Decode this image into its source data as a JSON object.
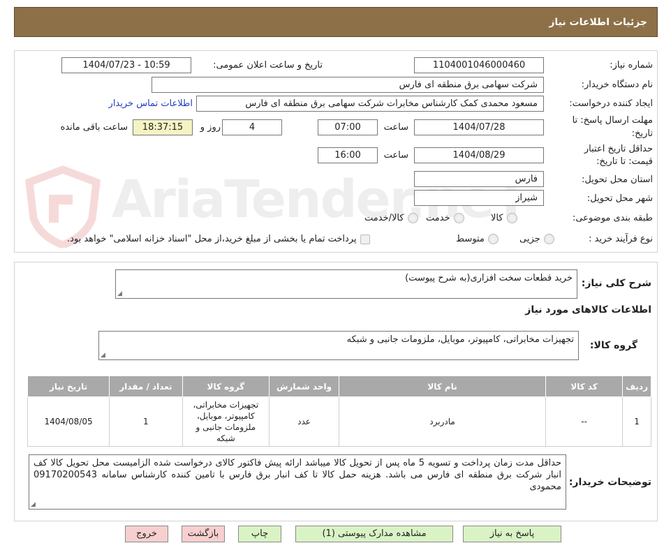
{
  "header": {
    "title": "جزئیات اطلاعات نیاز"
  },
  "watermark": {
    "text": "AriaTender.neT"
  },
  "fields": {
    "need_number_label": "شماره نیاز:",
    "need_number": "1104001046000460",
    "announce_label": "تاریخ و ساعت اعلان عمومی:",
    "announce_value": "1404/07/23 - 10:59",
    "buyer_org_label": "نام دستگاه خریدار:",
    "buyer_org": "شرکت سهامی برق منطقه ای فارس",
    "creator_label": "ایجاد کننده درخواست:",
    "creator": "مسعود محمدی کمک کارشناس مخابرات شرکت سهامی برق منطقه ای فارس",
    "contact_link": "اطلاعات تماس خریدار",
    "deadline_label_1": "مهلت ارسال پاسخ: تا",
    "deadline_label_2": "تاریخ:",
    "deadline_date": "1404/07/28",
    "time_word": "ساعت",
    "deadline_time": "07:00",
    "days_remaining": "4",
    "days_word": "روز و",
    "time_remaining": "18:37:15",
    "remaining_word": "ساعت باقی مانده",
    "validity_label_1": "حداقل تاریخ اعتبار",
    "validity_label_2": "قیمت: تا تاریخ:",
    "validity_date": "1404/08/29",
    "validity_time": "16:00",
    "province_label": "استان محل تحویل:",
    "province": "فارس",
    "city_label": "شهر محل تحویل:",
    "city": "شیراز",
    "category_label": "طبقه بندی موضوعی:",
    "category_options": [
      "کالا",
      "خدمت",
      "کالا/خدمت"
    ],
    "process_label": "نوع فرآیند خرید :",
    "process_options": [
      "جزیی",
      "متوسط"
    ],
    "treasury_note": "پرداخت تمام یا بخشی از مبلغ خرید،از محل \"اسناد خزانه اسلامی\" خواهد بود."
  },
  "summary": {
    "label": "شرح کلی نیاز:",
    "value": "خرید قطعات سخت افزاری(به شرح پیوست)",
    "items_title": "اطلاعات کالاهای مورد نیاز",
    "group_label": "گروه کالا:",
    "group_value": "تجهیزات مخابراتی، کامپیوتر، موبایل، ملزومات جانبی و شبکه"
  },
  "table": {
    "columns": [
      "ردیف",
      "کد کالا",
      "نام کالا",
      "واحد شمارش",
      "گروه کالا",
      "تعداد / مقدار",
      "تاریخ نیاز"
    ],
    "rows": [
      [
        "1",
        "--",
        "مادربرد",
        "عدد",
        "تجهیزات مخابراتی، کامپیوتر، موبایل، ملزومات جانبی و شبکه",
        "1",
        "1404/08/05"
      ]
    ]
  },
  "buyer_notes": {
    "label": "توضیحات خریدار:",
    "value": "حداقل مدت زمان پرداخت و تسویه 5 ماه پس از تحویل کالا میباشد ارائه پیش فاکتور کالای درخواست شده الزامیست محل تحویل کالا  کف انبار شرکت برق منطقه ای فارس می باشد. هزینه حمل کالا تا کف انبار برق فارس با تامین کننده  کارشناس سامانه 09170200543 محمودی"
  },
  "buttons": {
    "reply": "پاسخ به نیاز",
    "attachments": "مشاهده مدارک پیوستی (1)",
    "print": "چاپ",
    "back": "بازگشت",
    "exit": "خروج"
  },
  "colors": {
    "header": "#8d7047",
    "button_green": "#d9f3c5",
    "button_pink": "#f7cfcf",
    "table_header": "#a9a9a9",
    "timer_bg": "#f4f3c3"
  }
}
